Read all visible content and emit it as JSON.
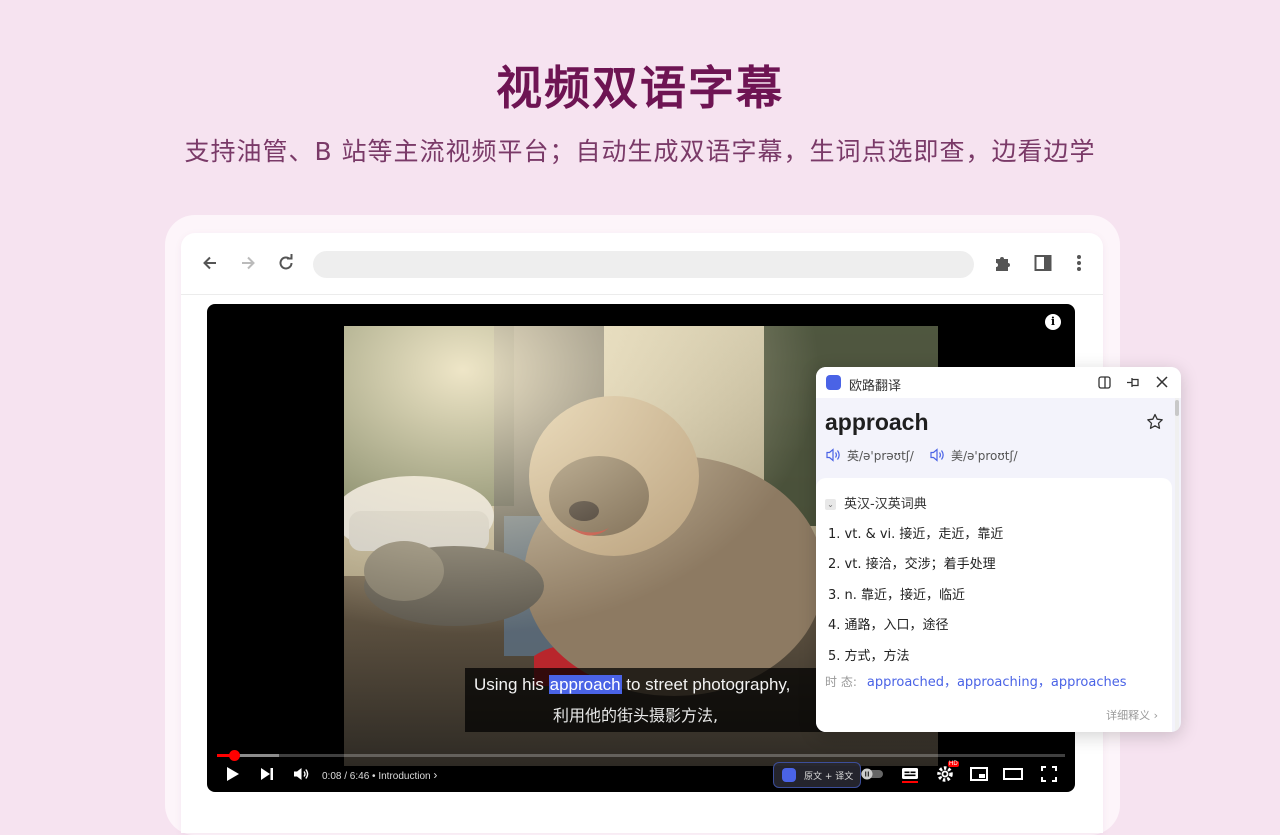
{
  "hero": {
    "title": "视频双语字幕",
    "subtitle": "支持油管、B 站等主流视频平台；自动生成双语字幕，生词点选即查，边看边学"
  },
  "browser": {
    "toolbar_icons": [
      "back-arrow-icon",
      "forward-arrow-icon",
      "reload-icon",
      "extensions-puzzle-icon",
      "side-panel-icon",
      "more-vert-icon"
    ],
    "address": ""
  },
  "video": {
    "subtitle_en_before": "Using his ",
    "subtitle_en_highlight": "approach",
    "subtitle_en_after": " to street photography,",
    "subtitle_zh": "利用他的街头摄影方法,",
    "time": "0:08 / 6:46",
    "chapter": "• Introduction",
    "progress_fraction": 0.02,
    "translate_button": "原文 + 译文",
    "hd_badge": "HD",
    "colors": {
      "progress": "#ff0000",
      "highlight": "#4a63e6"
    }
  },
  "popup": {
    "app_name": "欧路翻译",
    "word": "approach",
    "phonetic_uk": "英/ə'prəʊtʃ/",
    "phonetic_us": "美/ə'proʊtʃ/",
    "dictionary": "英汉-汉英词典",
    "definitions": [
      "1. vt. & vi. 接近，走近，靠近",
      "2. vt. 接洽，交涉；着手处理",
      "3. n. 靠近，接近，临近",
      "4. 通路，入口，途径",
      "5. 方式，方法"
    ],
    "tense_label": "时 态:",
    "tense_forms": "approached，approaching，approaches",
    "more_label": "详细释义"
  }
}
